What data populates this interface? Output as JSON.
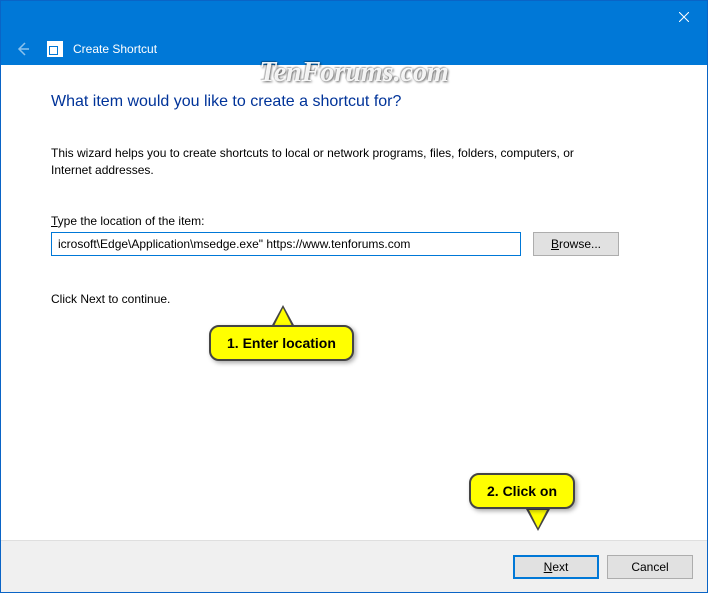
{
  "window": {
    "wizard_title": "Create Shortcut"
  },
  "content": {
    "heading": "What item would you like to create a shortcut for?",
    "intro": "This wizard helps you to create shortcuts to local or network programs, files, folders, computers, or Internet addresses.",
    "field_label_prefix": "T",
    "field_label_rest": "ype the location of the item:",
    "location_value": "icrosoft\\Edge\\Application\\msedge.exe\" https://www.tenforums.com",
    "browse_prefix": "B",
    "browse_rest": "rowse...",
    "continue_text": "Click Next to continue."
  },
  "buttons": {
    "next_prefix": "N",
    "next_rest": "ext",
    "cancel": "Cancel"
  },
  "annotations": {
    "callout1": "1. Enter location",
    "callout2": "2. Click on"
  },
  "watermark": "TenForums.com"
}
